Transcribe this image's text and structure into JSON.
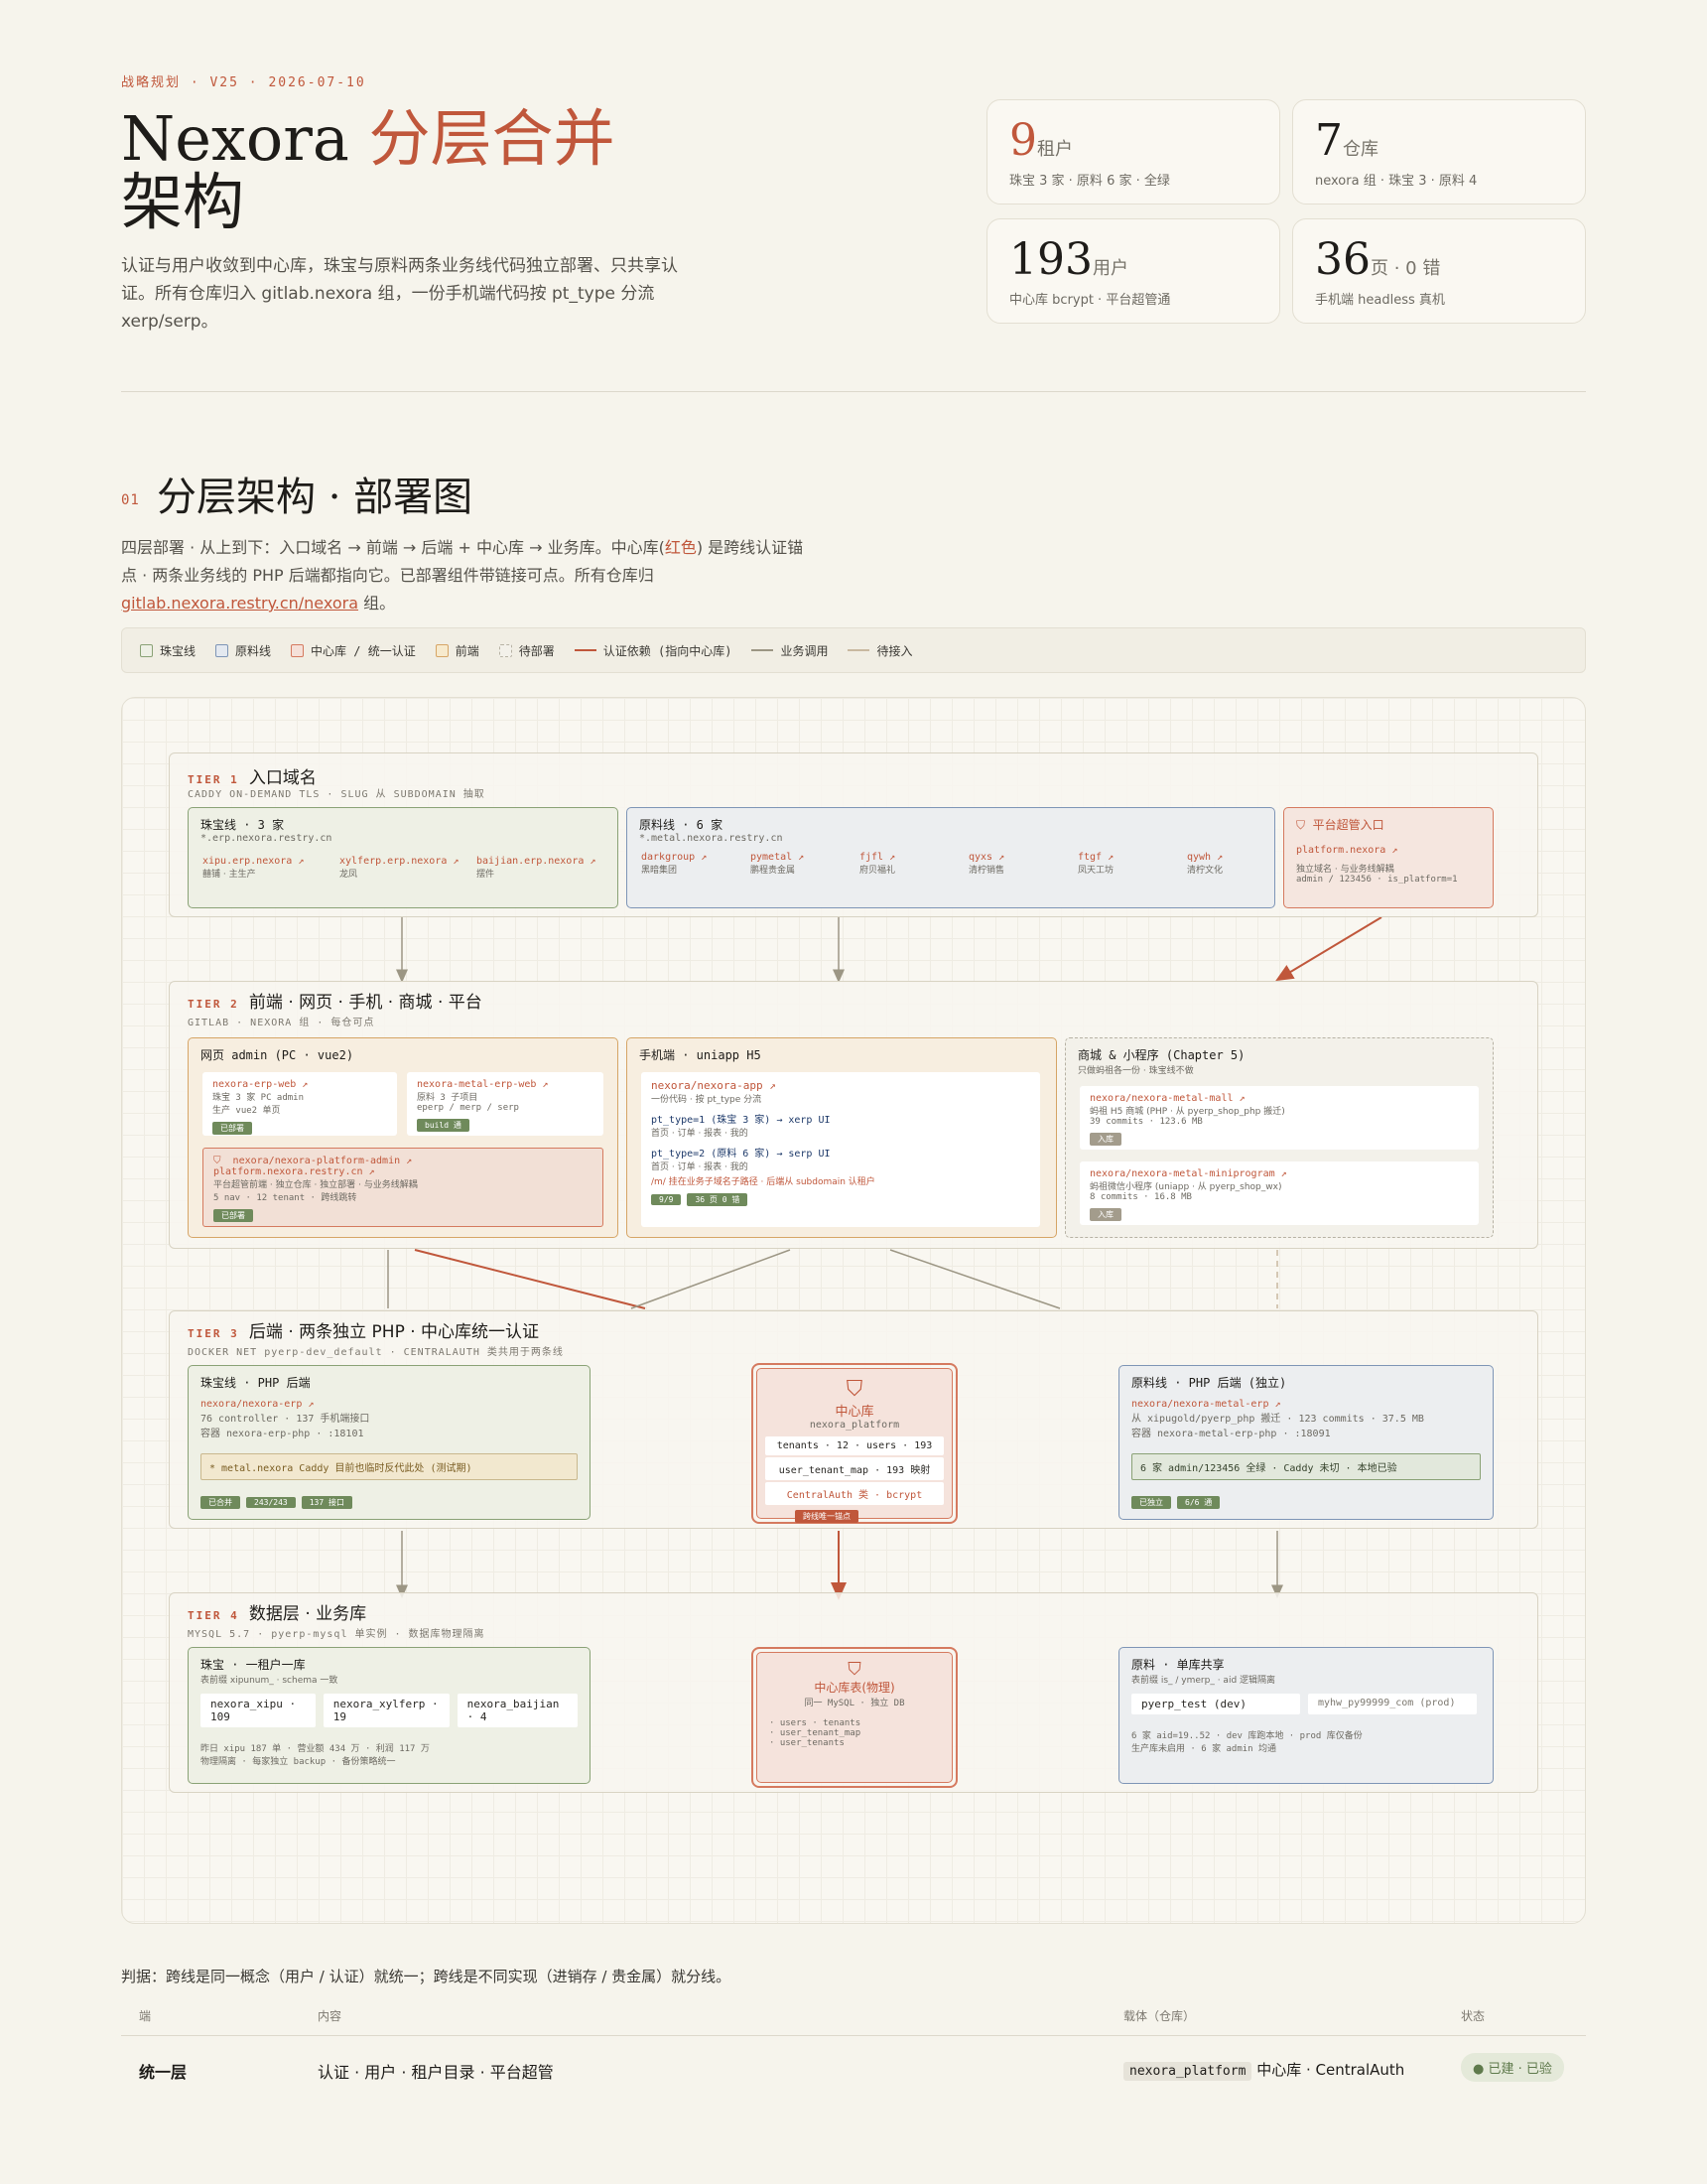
{
  "header": {
    "eyebrow": "战略规划 · V25 · 2026-07-10",
    "title_a": "Nexora ",
    "title_b": "分层合并",
    "title_c": "架构",
    "desc": "认证与用户收敛到中心库，珠宝与原料两条业务线代码独立部署、只共享认证。所有仓库归入 gitlab.nexora 组，一份手机端代码按 pt_type 分流 xerp/serp。"
  },
  "stats": [
    {
      "num": "9",
      "unit": "租户",
      "sub": "珠宝 3 家 · 原料 6 家 · 全绿"
    },
    {
      "num": "7",
      "unit": "仓库",
      "sub": "nexora 组 · 珠宝 3 · 原料 4"
    },
    {
      "num": "193",
      "unit": "用户",
      "sub": "中心库 bcrypt · 平台超管通"
    },
    {
      "num": "36",
      "unit": "页 · 0 错",
      "sub": "手机端 headless 真机"
    }
  ],
  "section": {
    "num": "01",
    "title": "分层架构 · 部署图",
    "desc_a": "四层部署 · 从上到下：入口域名 → 前端 → 后端 + 中心库 → 业务库。中心库(",
    "desc_red": "红色",
    "desc_b": ") 是跨线认证锚点 · 两条业务线的 PHP 后端都指向它。已部署组件带链接可点。所有仓库归 ",
    "desc_link": "gitlab.nexora.restry.cn/nexora",
    "desc_c": " 组。"
  },
  "legend": [
    {
      "label": "珠宝线",
      "fill": "#eef0e5",
      "stroke": "#8aa276"
    },
    {
      "label": "原料线",
      "fill": "#e4e9f0",
      "stroke": "#7e95b6"
    },
    {
      "label": "中心库 / 统一认证",
      "fill": "#f5e0d8",
      "stroke": "#d57a5f"
    },
    {
      "label": "前端",
      "fill": "#f7eacd",
      "stroke": "#d6a566"
    },
    {
      "label": "待部署",
      "fill": "#f3f1ea",
      "stroke": "#b7b2a4"
    }
  ],
  "legend_lines": [
    {
      "label": "认证依赖 (指向中心库)",
      "color": "#c0573b"
    },
    {
      "label": "业务调用",
      "color": "#9c9684"
    },
    {
      "label": "待接入",
      "color": "#c9b9a0"
    }
  ],
  "tier1": {
    "label": "TIER 1",
    "name": "入口域名",
    "sub": "CADDY ON-DEMAND TLS · SLUG 从 SUBDOMAIN 抽取",
    "jewel": {
      "title": "珠宝线 · 3 家",
      "domain": "*.erp.nexora.restry.cn",
      "items": [
        {
          "link": "xipu.erp.nexora ↗",
          "sub": "囍铺 · 主生产"
        },
        {
          "link": "xylferp.erp.nexora ↗",
          "sub": "龙凤"
        },
        {
          "link": "baijian.erp.nexora ↗",
          "sub": "摆件"
        }
      ]
    },
    "metal": {
      "title": "原料线 · 6 家",
      "domain": "*.metal.nexora.restry.cn",
      "items": [
        {
          "link": "darkgroup ↗",
          "sub": "黑暗集团"
        },
        {
          "link": "pymetal ↗",
          "sub": "鹏程贵金属"
        },
        {
          "link": "fjfl ↗",
          "sub": "府贝福礼"
        },
        {
          "link": "qyxs ↗",
          "sub": "清柠销售"
        },
        {
          "link": "ftgf ↗",
          "sub": "凤天工坊"
        },
        {
          "link": "qywh ↗",
          "sub": "清柠文化"
        }
      ]
    },
    "platform": {
      "title": "平台超管入口",
      "link": "platform.nexora ↗",
      "sub1": "独立域名 · 与业务线解耦",
      "sub2": "admin / 123456 · is_platform=1"
    }
  },
  "tier2": {
    "label": "TIER 2",
    "name": "前端 · 网页 · 手机 · 商城 · 平台",
    "sub": "GITLAB · NEXORA 组 · 每仓可点",
    "web": {
      "title": "网页 admin (PC · vue2)",
      "c1": {
        "link": "nexora-erp-web ↗",
        "l1": "珠宝 3 家 PC admin",
        "l2": "生产 vue2 单页",
        "tag": "已部署"
      },
      "c2": {
        "link": "nexora-metal-erp-web ↗",
        "l1": "原料 3 子项目",
        "l2": "eperp / merp / serp",
        "tag": "build 通"
      },
      "c3": {
        "link": "nexora/nexora-platform-admin ↗",
        "link2": "platform.nexora.restry.cn ↗",
        "l1": "平台超管前端 · 独立仓库 · 独立部署 · 与业务线解耦",
        "l2": "5 nav · 12 tenant · 跨线跳转",
        "tag": "已部署"
      }
    },
    "mobile": {
      "title": "手机端 · uniapp H5",
      "link": "nexora/nexora-app ↗",
      "l1": "一份代码 · 按 pt_type 分流",
      "p1": "pt_type=1 (珠宝 3 家) → xerp UI",
      "p1s": "首页 · 订单 · 报表 · 我的",
      "p2": "pt_type=2 (原料 6 家) → serp UI",
      "p2s": "首页 · 订单 · 报表 · 我的",
      "note": "/m/ 挂在业务子域名子路径 · 后端从 subdomain 认租户",
      "tag1": "9/9",
      "tag2": "36 页 0 错"
    },
    "mall": {
      "title": "商城 & 小程序 (Chapter 5)",
      "sub": "只做蚂祖各一份 · 珠宝线不做",
      "c1": {
        "link": "nexora/nexora-metal-mall ↗",
        "l1": "蚂祖 H5 商城 (PHP · 从 pyerp_shop_php 搬迁)",
        "l2": "39 commits · 123.6 MB",
        "tag": "入库"
      },
      "c2": {
        "link": "nexora/nexora-metal-miniprogram ↗",
        "l1": "蚂祖微信小程序 (uniapp · 从 pyerp_shop_wx)",
        "l2": "8 commits · 16.8 MB",
        "tag": "入库"
      }
    }
  },
  "tier3": {
    "label": "TIER 3",
    "name": "后端 · 两条独立 PHP · 中心库统一认证",
    "sub": "DOCKER NET pyerp-dev_default · CENTRALAUTH 类共用于两条线",
    "jewel": {
      "title": "珠宝线 · PHP 后端",
      "link": "nexora/nexora-erp ↗",
      "l1": "76 controller · 137 手机端接口",
      "l2": "容器 nexora-erp-php · :18101",
      "note": "* metal.nexora Caddy 目前也临时反代此处 (测试期)",
      "tags": [
        "已合并",
        "243/243",
        "137 接口"
      ]
    },
    "center": {
      "title": "中心库",
      "sub": "nexora_platform",
      "p1": "tenants · 12 · users · 193",
      "p2": "user_tenant_map · 193 映射",
      "p3": "CentralAuth 类 · bcrypt",
      "tag": "跨线唯一锚点"
    },
    "metal": {
      "title": "原料线 · PHP 后端 (独立)",
      "link": "nexora/nexora-metal-erp ↗",
      "l1": "从 xipugold/pyerp_php 搬迁 · 123 commits · 37.5 MB",
      "l2": "容器 nexora-metal-erp-php · :18091",
      "note": "6 家 admin/123456 全绿 · Caddy 未切 · 本地已验",
      "tags": [
        "已独立",
        "6/6 通"
      ]
    }
  },
  "tier4": {
    "label": "TIER 4",
    "name": "数据层 · 业务库",
    "sub": "MYSQL 5.7 · pyerp-mysql 单实例 · 数据库物理隔离",
    "jewel": {
      "title": "珠宝 · 一租户一库",
      "sub": "表前缀 xipunum_ · schema 一致",
      "p": [
        "nexora_xipu · 109",
        "nexora_xylferp · 19",
        "nexora_baijian · 4"
      ],
      "l1": "昨日 xipu 187 单 · 营业额 434 万 · 利润 117 万",
      "l2": "物理隔离 · 每家独立 backup · 备份策略统一"
    },
    "center": {
      "title": "中心库表(物理)",
      "sub": "同一 MySQL · 独立 DB",
      "items": [
        "· users · tenants",
        "· user_tenant_map",
        "· user_tenants"
      ]
    },
    "metal": {
      "title": "原料 · 单库共享",
      "sub": "表前缀 is_ / ymerp_ · aid 逻辑隔离",
      "p": [
        "pyerp_test (dev)",
        "myhw_py99999_com (prod)"
      ],
      "l1": "6 家 aid=19..52 · dev 库跑本地 · prod 库仅备份",
      "l2": "生产库未启用 · 6 家 admin 均通"
    }
  },
  "judge": "判据：跨线是同一概念（用户 / 认证）就统一；跨线是不同实现（进销存 / 贵金属）就分线。",
  "table": {
    "headers": [
      "端",
      "内容",
      "载体（仓库）",
      "状态"
    ],
    "row": {
      "c1": "统一层",
      "c2": "认证 · 用户 · 租户目录 · 平台超管",
      "c3code": "nexora_platform",
      "c3": "中心库 · CentralAuth",
      "c4": "● 已建 · 已验"
    }
  }
}
